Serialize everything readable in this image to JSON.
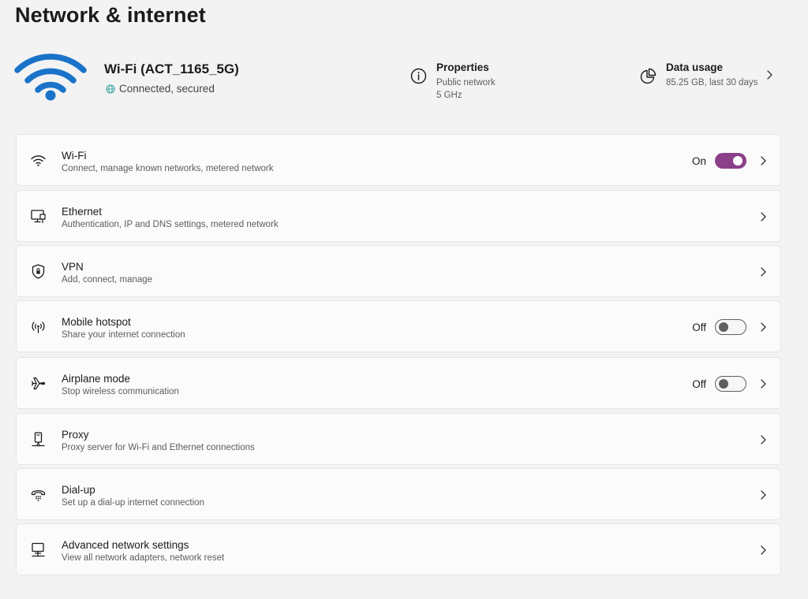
{
  "page": {
    "title": "Network & internet"
  },
  "hero": {
    "network_name": "Wi-Fi (ACT_1165_5G)",
    "status": "Connected, secured",
    "properties": {
      "title": "Properties",
      "line1": "Public network",
      "line2": "5 GHz"
    },
    "data_usage": {
      "title": "Data usage",
      "detail": "85.25 GB, last 30 days"
    }
  },
  "accent_color": "#8b3f89",
  "settings": [
    {
      "icon": "wifi-icon",
      "title": "Wi-Fi",
      "subtitle": "Connect, manage known networks, metered network",
      "toggle": "On"
    },
    {
      "icon": "ethernet-icon",
      "title": "Ethernet",
      "subtitle": "Authentication, IP and DNS settings, metered network"
    },
    {
      "icon": "shield-icon",
      "title": "VPN",
      "subtitle": "Add, connect, manage"
    },
    {
      "icon": "hotspot-icon",
      "title": "Mobile hotspot",
      "subtitle": "Share your internet connection",
      "toggle": "Off"
    },
    {
      "icon": "airplane-icon",
      "title": "Airplane mode",
      "subtitle": "Stop wireless communication",
      "toggle": "Off"
    },
    {
      "icon": "proxy-icon",
      "title": "Proxy",
      "subtitle": "Proxy server for Wi-Fi and Ethernet connections"
    },
    {
      "icon": "dialup-icon",
      "title": "Dial-up",
      "subtitle": "Set up a dial-up internet connection"
    },
    {
      "icon": "computer-network-icon",
      "title": "Advanced network settings",
      "subtitle": "View all network adapters, network reset"
    }
  ]
}
